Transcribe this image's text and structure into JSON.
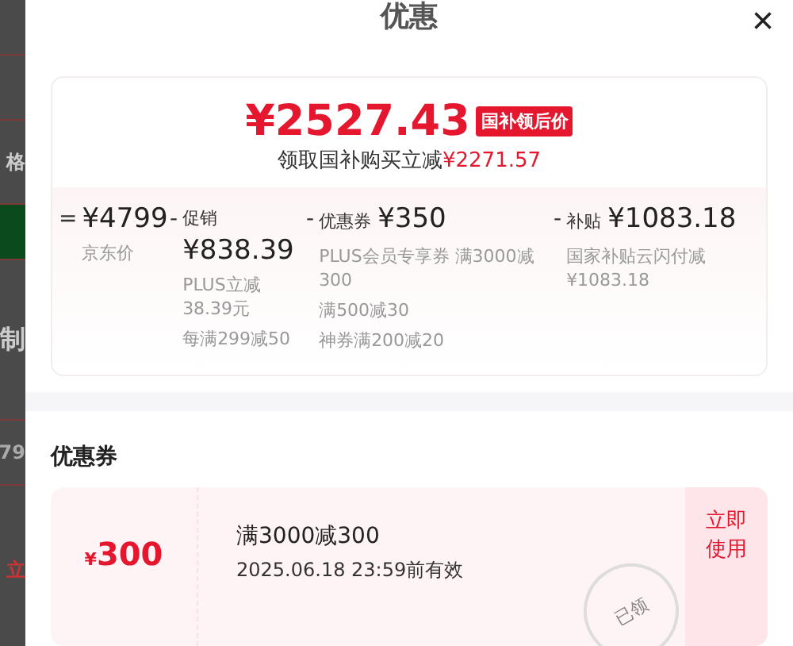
{
  "backdrop": {
    "texts": [
      "格",
      "制",
      "79",
      "立"
    ]
  },
  "sheet": {
    "title": "优惠",
    "close": "×"
  },
  "price_card": {
    "final_price": "¥2527.43",
    "badge": "国补领后价",
    "saving_label": "领取国补购买立减",
    "saving_amount": "¥2271.57",
    "terms": [
      {
        "kind": "base",
        "op": "=",
        "amount": "¥4799",
        "label": "京东价"
      },
      {
        "kind": "deduction",
        "op": "-",
        "label": "促销",
        "amount": "¥838.39",
        "notes": [
          "PLUS立减38.39元",
          "每满299减50"
        ]
      },
      {
        "kind": "deduction",
        "op": "-",
        "label": "优惠券",
        "amount": "¥350",
        "notes": [
          "PLUS会员专享券 满3000减300",
          "满500减30",
          "神券满200减20"
        ]
      },
      {
        "kind": "deduction",
        "op": "-",
        "label": "补贴",
        "amount": "¥1083.18",
        "notes": [
          "国家补贴云闪付减¥1083.18"
        ]
      }
    ]
  },
  "coupons": {
    "heading": "优惠券",
    "items": [
      {
        "currency": "¥",
        "value": "300",
        "title": "满3000减300",
        "validity": "2025.06.18 23:59前有效",
        "action": "立即使用",
        "stamp": "已领"
      }
    ]
  }
}
